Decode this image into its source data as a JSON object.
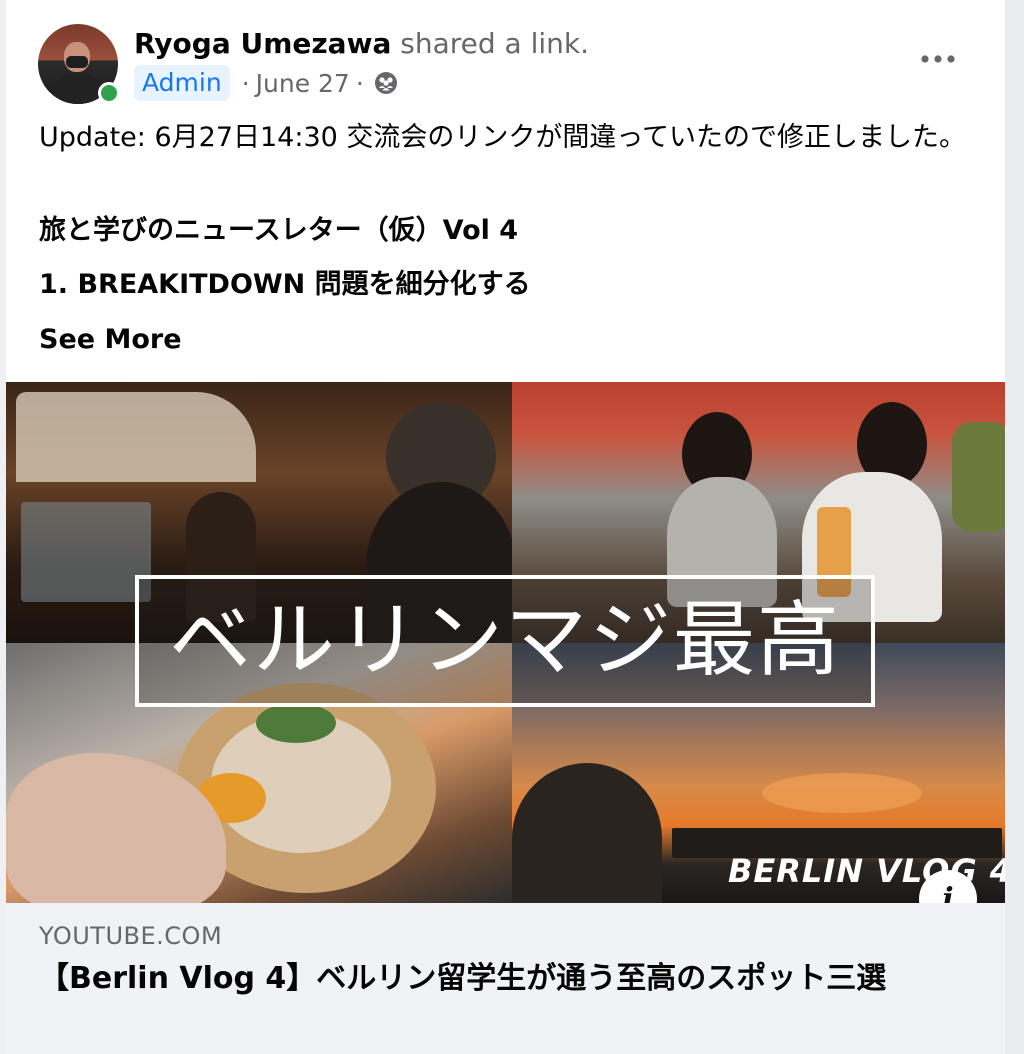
{
  "post": {
    "author": "Ryoga Umezawa",
    "action": "shared a link.",
    "badge": "Admin",
    "separator": "·",
    "date": "June 27",
    "text": "Update: 6月27日14:30 交流会のリンクが間違っていたので修正しました。",
    "heading_1": "旅と学びのニュースレター（仮）Vol 4",
    "heading_2": "1. BREAKITDOWN 問題を細分化する",
    "see_more": "See More"
  },
  "thumbnail": {
    "overlay_title": "ベルリンマジ最高",
    "vlog_label": "BERLIN VLOG 4"
  },
  "link": {
    "domain": "YOUTUBE.COM",
    "title": "【Berlin Vlog 4】ベルリン留学生が通う至高のスポット三選"
  },
  "icons": {
    "more": "more-horizontal-icon",
    "audience": "friends-group-icon",
    "info": "info-icon"
  },
  "colors": {
    "badge_bg": "#e7f3ff",
    "badge_text": "#1877f2",
    "online": "#31a24c",
    "secondary_text": "#65676b"
  }
}
